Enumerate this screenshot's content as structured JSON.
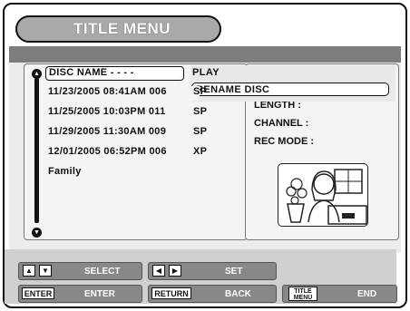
{
  "menu": {
    "title": "TITLE MENU"
  },
  "titles": [
    {
      "name": "DISC NAME - - - -",
      "mode": ""
    },
    {
      "name": "11/23/2005 08:41AM 006",
      "mode": "SP"
    },
    {
      "name": "11/25/2005 10:03PM 011",
      "mode": "SP"
    },
    {
      "name": "11/29/2005 11:30AM 009",
      "mode": "SP"
    },
    {
      "name": "12/01/2005 06:52PM 006",
      "mode": "XP"
    },
    {
      "name": "Family",
      "mode": ""
    }
  ],
  "popup": {
    "play": "PLAY",
    "rename": "RENAME DISC"
  },
  "info": {
    "length": "LENGTH   :",
    "channel": "CHANNEL  :",
    "rec_mode": "REC MODE :"
  },
  "footer": {
    "select": "SELECT",
    "set": "SET",
    "enter_key": "ENTER",
    "enter": "ENTER",
    "return_key": "RETURN",
    "back": "BACK",
    "title_menu_key_line1": "TITLE",
    "title_menu_key_line2": "MENU",
    "end": "END"
  }
}
